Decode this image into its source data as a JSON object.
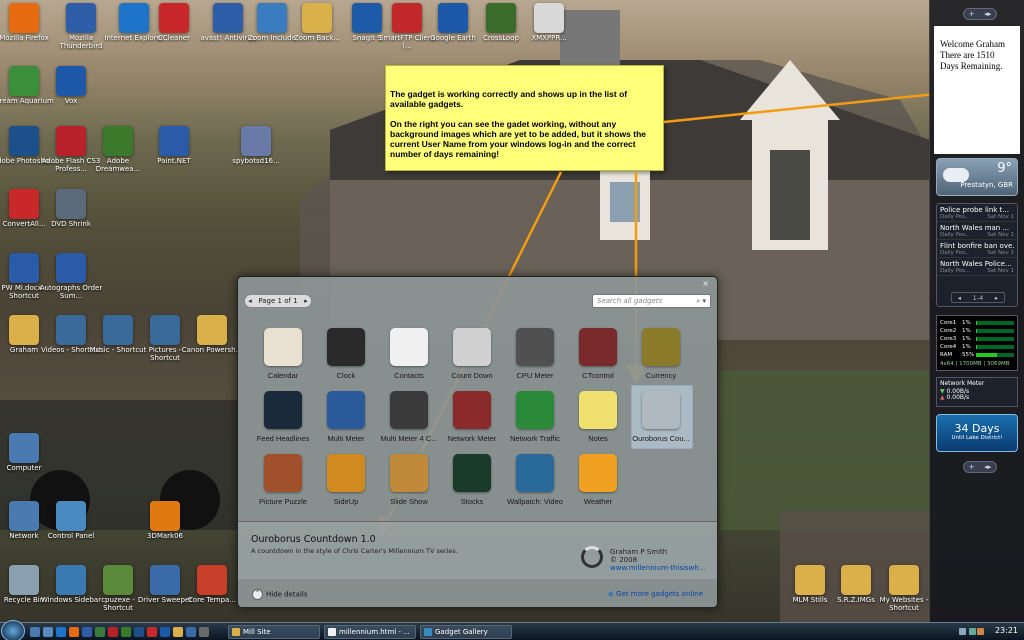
{
  "desktop": {
    "icons": [
      {
        "label": "Mozilla Firefox",
        "icon": "firefox-icon",
        "color": "#e66a10"
      },
      {
        "label": "Mozilla Thunderbird",
        "icon": "thunderbird-icon",
        "color": "#2f5ea8"
      },
      {
        "label": "Internet Explorer",
        "icon": "ie-icon",
        "color": "#1e74c8"
      },
      {
        "label": "CCleaner",
        "icon": "ccleaner-icon",
        "color": "#c8282a"
      },
      {
        "label": "avast! Antivirus",
        "icon": "avast-icon",
        "color": "#2f5ea8"
      },
      {
        "label": "Zoom Include",
        "icon": "zoom-icon",
        "color": "#3b7bc0"
      },
      {
        "label": "Zoom Back...",
        "icon": "folder-icon",
        "color": "#d9b04a"
      },
      {
        "label": "SnagIt 9",
        "icon": "snagit-icon",
        "color": "#1d5aa8"
      },
      {
        "label": "SmartFTP Client (...",
        "icon": "smartftp-icon",
        "color": "#c0282a"
      },
      {
        "label": "Google Earth",
        "icon": "google-earth-icon",
        "color": "#1e58a8"
      },
      {
        "label": "CrossLoop",
        "icon": "crossloop-icon",
        "color": "#3b6b2a"
      },
      {
        "label": "XMXPPR...",
        "icon": "document-icon",
        "color": "#d8d8d8"
      },
      {
        "label": "Dream Aquarium",
        "icon": "aquarium-icon",
        "color": "#3b8f3a"
      },
      {
        "label": "Vox",
        "icon": "vox-icon",
        "color": "#1e58a8"
      },
      {
        "label": "Adobe Photosho...",
        "icon": "photoshop-icon",
        "color": "#1d4f8a"
      },
      {
        "label": "Adobe Flash CS3 Profess...",
        "icon": "flash-icon",
        "color": "#b8202a"
      },
      {
        "label": "Adobe Dreamwea...",
        "icon": "dreamweaver-icon",
        "color": "#3a7a2a"
      },
      {
        "label": "Paint.NET",
        "icon": "paintnet-icon",
        "color": "#2a5aa8"
      },
      {
        "label": "spybotsd16...",
        "icon": "installer-icon",
        "color": "#6a7aa8"
      },
      {
        "label": "ConvertAll...",
        "icon": "convertdvd-icon",
        "color": "#c8282a"
      },
      {
        "label": "DVD Shrink",
        "icon": "dvdshrink-icon",
        "color": "#5a6a7a"
      },
      {
        "label": "PW Mi.docx - Shortcut",
        "icon": "word-doc-icon",
        "color": "#2a5aa8"
      },
      {
        "label": "Autographs Order Sum...",
        "icon": "doc-shortcut-icon",
        "color": "#2a5aa8"
      },
      {
        "label": "Graham",
        "icon": "user-folder-icon",
        "color": "#d9b04a"
      },
      {
        "label": "Videos - Shortcut",
        "icon": "videos-icon",
        "color": "#3a6a9a"
      },
      {
        "label": "Music - Shortcut",
        "icon": "music-icon",
        "color": "#3a6a9a"
      },
      {
        "label": "Pictures - Shortcut",
        "icon": "pictures-icon",
        "color": "#3a6a9a"
      },
      {
        "label": "Canon Powersh...",
        "icon": "canon-icon",
        "color": "#d9b04a"
      },
      {
        "label": "Computer",
        "icon": "computer-icon",
        "color": "#4a7ab0"
      },
      {
        "label": "Network",
        "icon": "network-icon",
        "color": "#4a7ab0"
      },
      {
        "label": "Control Panel",
        "icon": "control-panel-icon",
        "color": "#4a8ac0"
      },
      {
        "label": "3DMark06",
        "icon": "3dmark-icon",
        "color": "#e07a10"
      },
      {
        "label": "Recycle Bin",
        "icon": "recycle-bin-icon",
        "color": "#8aa0b0"
      },
      {
        "label": "Windows Sidebar",
        "icon": "sidebar-icon",
        "color": "#3a7ab0"
      },
      {
        "label": "cpuzexe - Shortcut",
        "icon": "cpuz-icon",
        "color": "#5a8a3a"
      },
      {
        "label": "Driver Sweeper",
        "icon": "driver-sweeper-icon",
        "color": "#3a6aa8"
      },
      {
        "label": "Core Tempa...",
        "icon": "core-temp-icon",
        "color": "#c8402a"
      },
      {
        "label": "MLM Stills",
        "icon": "folder-icon",
        "color": "#d9b04a"
      },
      {
        "label": "S.R.Z.IMGs",
        "icon": "folder-icon",
        "color": "#d9b04a"
      },
      {
        "label": "My Websites - Shortcut",
        "icon": "folder-shortcut-icon",
        "color": "#d9b04a"
      }
    ]
  },
  "note": {
    "para1": "The gadget is working correctly and shows up in the list of available gadgets.",
    "para2": "On the right you can see the gadet working, without any background images which are yet to be added, but it shows the current User Name from your windows log-in and the correct number of days remaining!"
  },
  "sidebar": {
    "welcome_line1": "Welcome Graham",
    "welcome_line2": "There are 1510",
    "welcome_line3": "Days Remaining.",
    "weather": {
      "temp": "9°",
      "location": "Prestatyn, GBR"
    },
    "news": [
      {
        "title": "Police probe link t...",
        "source": "Daily Pos...",
        "date": "Sat Nov 1"
      },
      {
        "title": "North Wales man ...",
        "source": "Daily Pos...",
        "date": "Sat Nov 1"
      },
      {
        "title": "Flint bonfire ban ove...",
        "source": "Daily Pos...",
        "date": "Sat Nov 1"
      },
      {
        "title": "North Wales Police...",
        "source": "Daily Pos...",
        "date": "Sat Nov 1"
      }
    ],
    "news_pager": "1-4",
    "cpu": [
      {
        "label": "Core1",
        "value": "1%"
      },
      {
        "label": "Core2",
        "value": "1%"
      },
      {
        "label": "Core3",
        "value": "1%"
      },
      {
        "label": "Core4",
        "value": "1%"
      },
      {
        "label": "RAM",
        "value": "55%"
      }
    ],
    "cpu_footer": "4x64 | 1700MB | 3069MB",
    "ram_fraction": 0.55,
    "netmeter": {
      "title": "Network Meter",
      "down": "0.00B/s",
      "up": "0.00B/s"
    },
    "countdown": {
      "number": "34 Days",
      "subtitle": "Until Lake District!"
    }
  },
  "gallery": {
    "close": "×",
    "pager": "Page 1 of 1",
    "search_placeholder": "Search all gadgets",
    "tiles": [
      {
        "label": "Calendar",
        "icon": "calendar-icon",
        "color": "#e8e0d0"
      },
      {
        "label": "Clock",
        "icon": "clock-icon",
        "color": "#2a2a2a"
      },
      {
        "label": "Contacts",
        "icon": "contacts-icon",
        "color": "#f0f0f0"
      },
      {
        "label": "Count Down",
        "icon": "stopwatch-icon",
        "color": "#d0d0d0"
      },
      {
        "label": "CPU Meter",
        "icon": "cpu-meter-icon",
        "color": "#505050"
      },
      {
        "label": "CTcontrol",
        "icon": "ctcontrol-icon",
        "color": "#7a2a2a"
      },
      {
        "label": "Currency",
        "icon": "currency-icon",
        "color": "#8a7a2a"
      },
      {
        "label": "Feed Headlines",
        "icon": "feed-headlines-icon",
        "color": "#1a2a3a"
      },
      {
        "label": "Multi Meter",
        "icon": "multi-meter-icon",
        "color": "#2a5a9a"
      },
      {
        "label": "Multi Meter 4 C...",
        "icon": "multi-meter-4-icon",
        "color": "#3a3a3a"
      },
      {
        "label": "Network Meter",
        "icon": "network-meter-icon",
        "color": "#8a2a2a"
      },
      {
        "label": "Network Traffic",
        "icon": "network-traffic-icon",
        "color": "#2a8a3a"
      },
      {
        "label": "Notes",
        "icon": "notes-icon",
        "color": "#f0e070"
      },
      {
        "label": "Ouroborus Cou...",
        "icon": "ouroborus-icon",
        "color": "#b0b8c0"
      },
      {
        "label": "Picture Puzzle",
        "icon": "picture-puzzle-icon",
        "color": "#a0502a"
      },
      {
        "label": "SideUp",
        "icon": "sideup-icon",
        "color": "#d08a20"
      },
      {
        "label": "Slide Show",
        "icon": "slideshow-icon",
        "color": "#c08a3a"
      },
      {
        "label": "Stocks",
        "icon": "stocks-icon",
        "color": "#1a3a2a"
      },
      {
        "label": "Wallpatch: Video",
        "icon": "wallpatch-icon",
        "color": "#2a6a9a"
      },
      {
        "label": "Weather",
        "icon": "weather-icon",
        "color": "#f0a020"
      }
    ],
    "selected": "Ouroborus Cou...",
    "detail": {
      "title": "Ouroborus Countdown 1.0",
      "description": "A countdown in the style of Chris Carter's Millennium TV series.",
      "author": "Graham P Smith",
      "copyright": "© 2008",
      "url": "www.millennium-thisiswh..."
    },
    "hide_details": "Hide details",
    "more_online": "Get more gadgets online"
  },
  "taskbar": {
    "buttons": [
      {
        "label": "Mill Site",
        "icon": "folder-icon",
        "color": "#d9b04a"
      },
      {
        "label": "millennium.html - ...",
        "icon": "html-doc-icon",
        "color": "#f0f0f0"
      },
      {
        "label": "Gadget Gallery",
        "icon": "gadget-gallery-icon",
        "color": "#3a8ac0"
      }
    ],
    "time": "23:21"
  }
}
